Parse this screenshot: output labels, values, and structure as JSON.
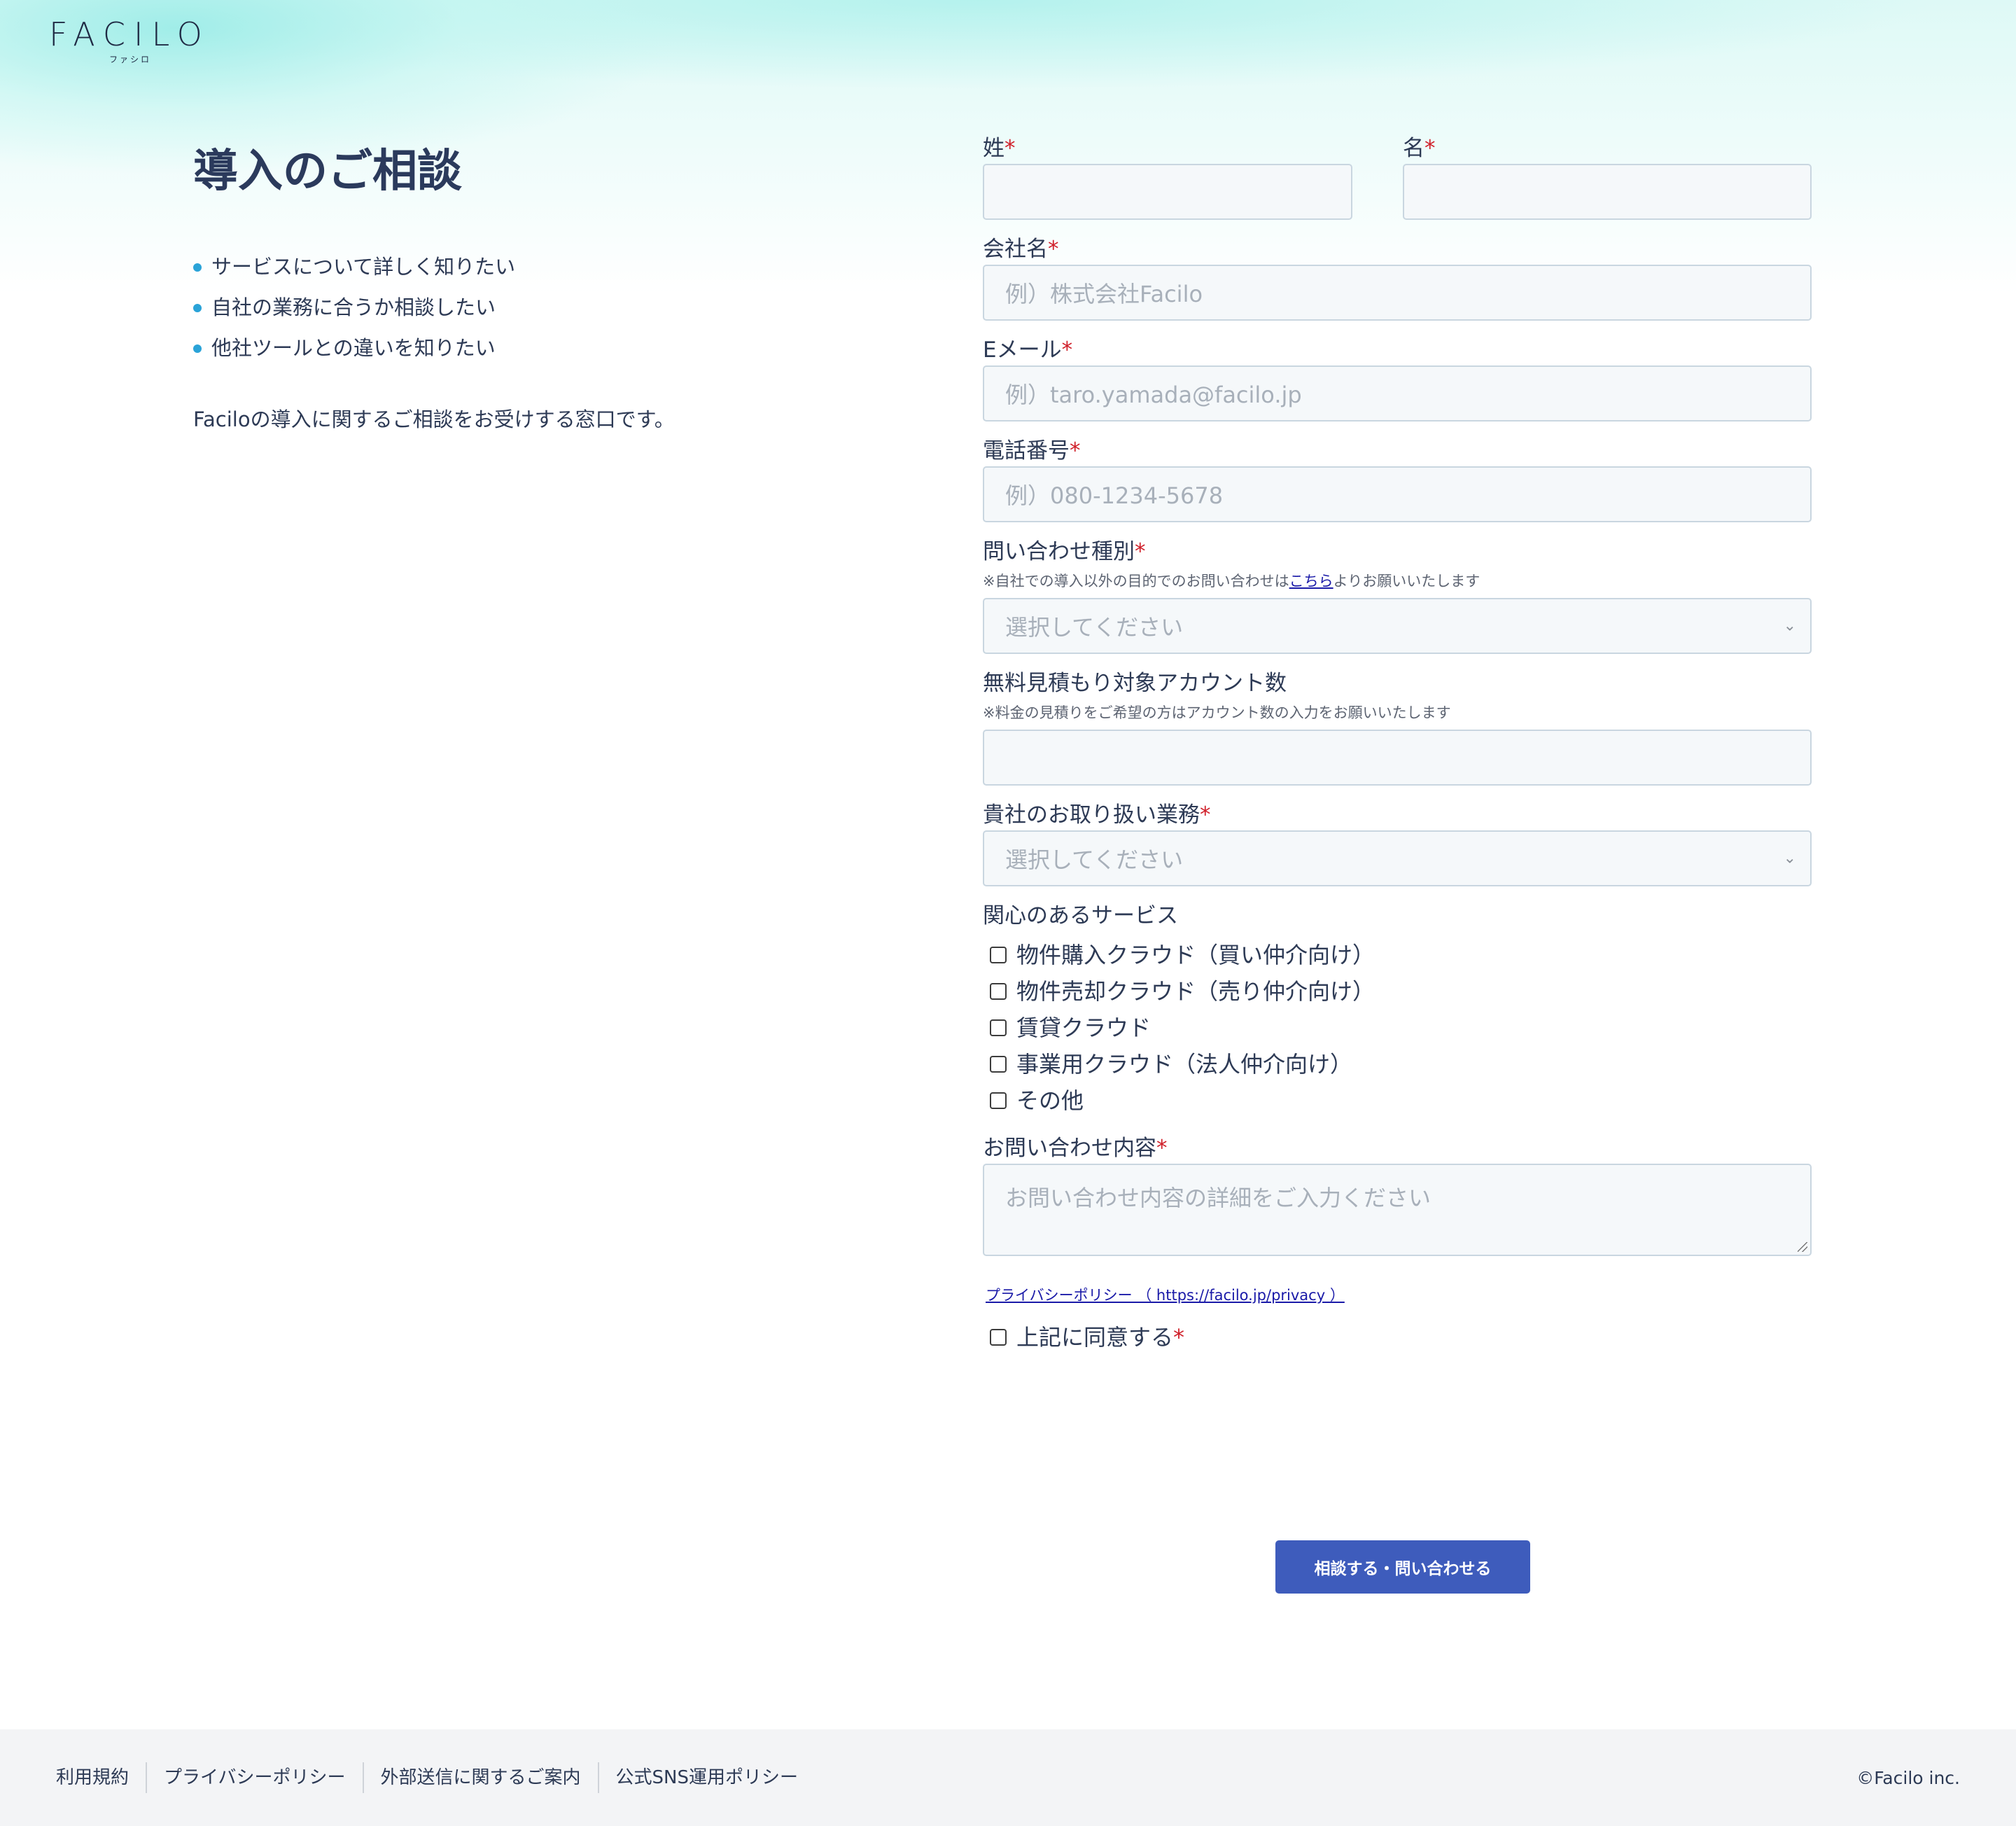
{
  "brand": {
    "logo_main": "FACILO",
    "logo_sub": "ファシロ"
  },
  "left": {
    "title": "導入のご相談",
    "bullets": [
      "サービスについて詳しく知りたい",
      "自社の業務に合うか相談したい",
      "他社ツールとの違いを知りたい"
    ],
    "intro": "Faciloの導入に関するご相談をお受けする窓口です。"
  },
  "form": {
    "last_name": {
      "label": "姓",
      "req": "*",
      "placeholder": ""
    },
    "first_name": {
      "label": "名",
      "req": "*",
      "placeholder": ""
    },
    "company": {
      "label": "会社名",
      "req": "*",
      "placeholder": "例）株式会社Facilo"
    },
    "email": {
      "label": "Eメール",
      "req": "*",
      "placeholder": "例）taro.yamada@facilo.jp"
    },
    "phone": {
      "label": "電話番号",
      "req": "*",
      "placeholder": "例）080-1234-5678"
    },
    "inquiry_type": {
      "label": "問い合わせ種別",
      "req": "*",
      "note_pre": "※自社での導入以外の目的でのお問い合わせは",
      "note_link": "こちら",
      "note_post": "よりお願いいたします",
      "selected": "選択してください"
    },
    "accounts": {
      "label": "無料見積もり対象アカウント数",
      "note": "※料金の見積りをご希望の方はアカウント数の入力をお願いいたします",
      "placeholder": ""
    },
    "business": {
      "label": "貴社のお取り扱い業務",
      "req": "*",
      "selected": "選択してください"
    },
    "services": {
      "label": "関心のあるサービス",
      "options": [
        "物件購入クラウド（買い仲介向け）",
        "物件売却クラウド（売り仲介向け）",
        "賃貸クラウド",
        "事業用クラウド（法人仲介向け）",
        "その他"
      ]
    },
    "message": {
      "label": "お問い合わせ内容",
      "req": "*",
      "placeholder": "お問い合わせ内容の詳細をご入力ください"
    },
    "privacy_link": "プライバシーポリシー （ https://facilo.jp/privacy ）",
    "agree": {
      "label": "上記に同意する",
      "req": "*"
    },
    "submit": "相談する・問い合わせる"
  },
  "footer": {
    "links": [
      "利用規約",
      "プライバシーポリシー",
      "外部送信に関するご案内",
      "公式SNS運用ポリシー"
    ],
    "copyright": "©Facilo inc."
  },
  "colors": {
    "accent": "#3e5cbc",
    "bullet": "#2aa3d8",
    "required": "#d0202a",
    "link": "#1a1aa8"
  }
}
